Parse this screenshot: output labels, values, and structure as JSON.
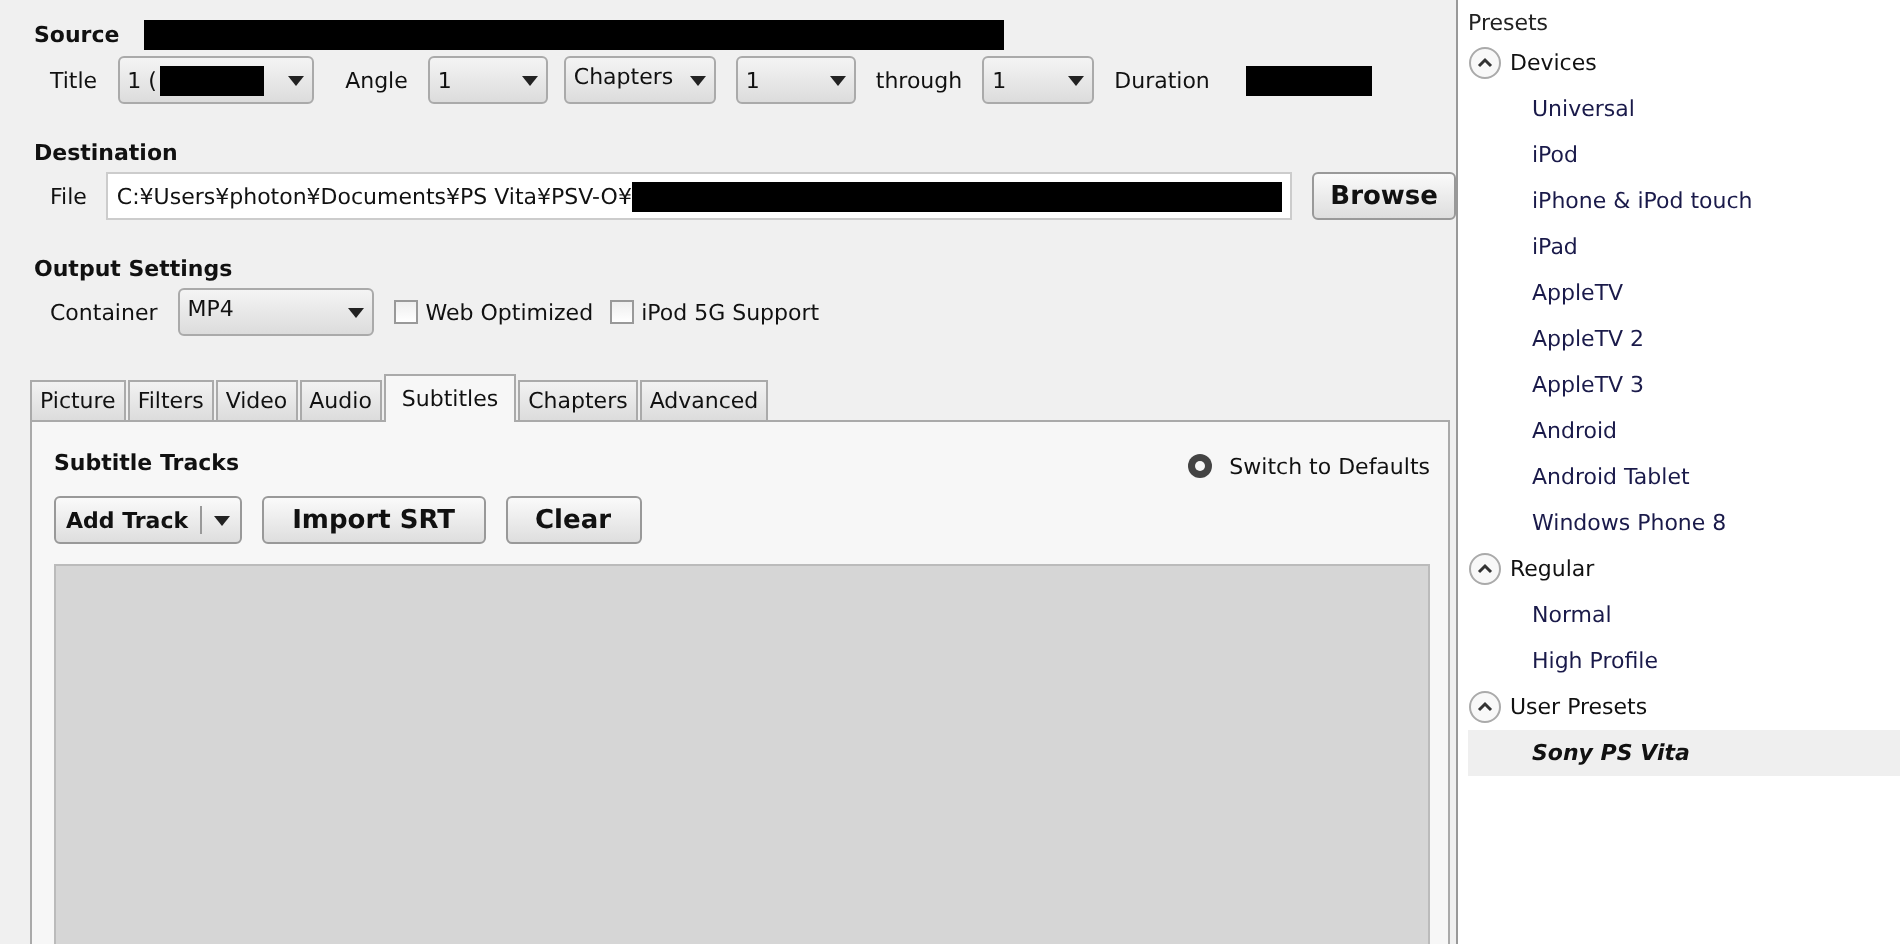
{
  "source": {
    "label": "Source",
    "title_label": "Title",
    "title_value": "1 (",
    "angle_label": "Angle",
    "angle_value": "1",
    "range_type": "Chapters",
    "range_start": "1",
    "through_label": "through",
    "range_end": "1",
    "duration_label": "Duration"
  },
  "destination": {
    "label": "Destination",
    "file_label": "File",
    "file_value": "C:¥Users¥photon¥Documents¥PS Vita¥PSV-O¥",
    "browse": "Browse"
  },
  "output": {
    "label": "Output Settings",
    "container_label": "Container",
    "container_value": "MP4",
    "options": [
      {
        "label": "Web Optimized",
        "checked": false
      },
      {
        "label": "iPod 5G Support",
        "checked": false
      }
    ]
  },
  "tabs": [
    {
      "label": "Picture",
      "selected": false
    },
    {
      "label": "Filters",
      "selected": false
    },
    {
      "label": "Video",
      "selected": false
    },
    {
      "label": "Audio",
      "selected": false
    },
    {
      "label": "Subtitles",
      "selected": true
    },
    {
      "label": "Chapters",
      "selected": false
    },
    {
      "label": "Advanced",
      "selected": false
    }
  ],
  "subtitles": {
    "title": "Subtitle Tracks",
    "defaults": "Switch to Defaults",
    "buttons": [
      {
        "label": "Add Track",
        "kind": "split"
      },
      {
        "label": "Import SRT",
        "kind": "plain"
      },
      {
        "label": "Clear",
        "kind": "plain"
      }
    ]
  },
  "presets": {
    "title": "Presets",
    "groups": [
      {
        "name": "Devices",
        "expanded": true,
        "items": [
          {
            "label": "Universal",
            "selected": false
          },
          {
            "label": "iPod",
            "selected": false
          },
          {
            "label": "iPhone & iPod touch",
            "selected": false
          },
          {
            "label": "iPad",
            "selected": false
          },
          {
            "label": "AppleTV",
            "selected": false
          },
          {
            "label": "AppleTV 2",
            "selected": false
          },
          {
            "label": "AppleTV 3",
            "selected": false
          },
          {
            "label": "Android",
            "selected": false
          },
          {
            "label": "Android Tablet",
            "selected": false
          },
          {
            "label": "Windows Phone 8",
            "selected": false
          }
        ]
      },
      {
        "name": "Regular",
        "expanded": true,
        "items": [
          {
            "label": "Normal",
            "selected": false
          },
          {
            "label": "High Profile",
            "selected": false
          }
        ]
      },
      {
        "name": "User Presets",
        "expanded": true,
        "items": [
          {
            "label": "Sony PS Vita",
            "selected": true
          }
        ]
      }
    ]
  }
}
